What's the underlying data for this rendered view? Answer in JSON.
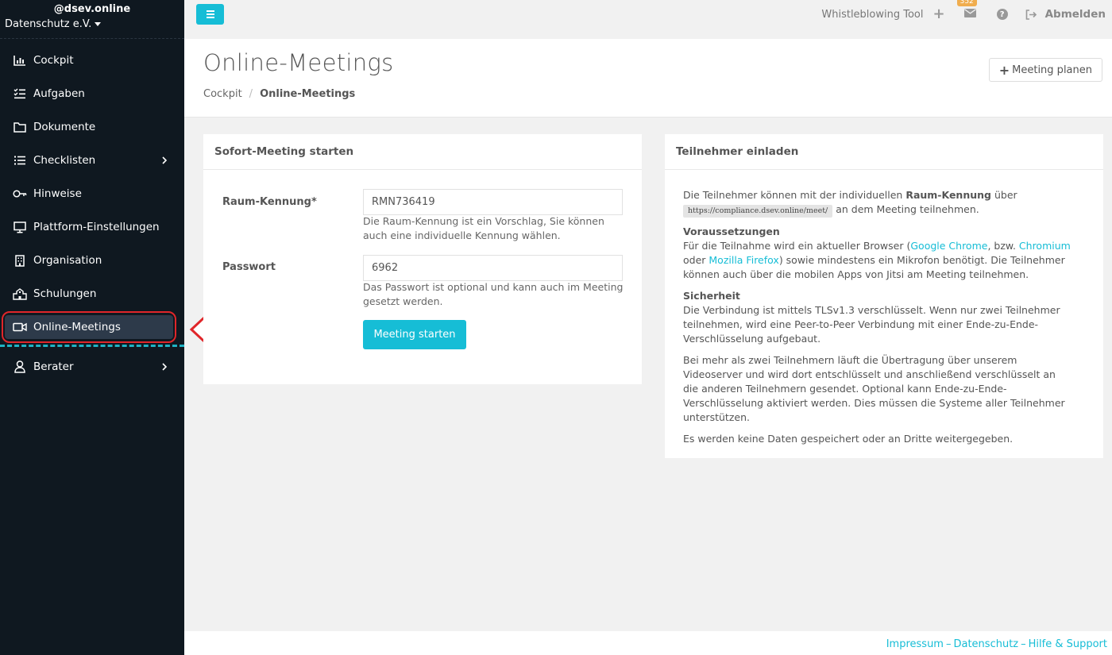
{
  "brand": {
    "name": "@dsev.online",
    "org": "Datenschutz e.V."
  },
  "sidebar": {
    "items": [
      {
        "label": "Cockpit",
        "icon": "chart-icon"
      },
      {
        "label": "Aufgaben",
        "icon": "tasks-icon"
      },
      {
        "label": "Dokumente",
        "icon": "folder-icon"
      },
      {
        "label": "Checklisten",
        "icon": "list-icon"
      },
      {
        "label": "Hinweise",
        "icon": "key-icon"
      },
      {
        "label": "Plattform-Einstellungen",
        "icon": "monitor-icon"
      },
      {
        "label": "Organisation",
        "icon": "building-icon"
      },
      {
        "label": "Schulungen",
        "icon": "school-icon"
      },
      {
        "label": "Online-Meetings",
        "icon": "video-icon"
      },
      {
        "label": "Berater",
        "icon": "user-icon"
      }
    ],
    "active": "Online-Meetings"
  },
  "topbar": {
    "tool_label": "Whistleblowing Tool",
    "mail_count": "352",
    "logout_label": "Abmelden"
  },
  "header": {
    "title": "Online-Meetings",
    "breadcrumb_root": "Cockpit",
    "breadcrumb_current": "Online-Meetings",
    "plan_button": "Meeting planen"
  },
  "left_card": {
    "title": "Sofort-Meeting starten",
    "room_label": "Raum-Kennung*",
    "room_value": "RMN736419",
    "room_help": "Die Raum-Kennung ist ein Vorschlag, Sie können auch eine individuelle Kennung wählen.",
    "password_label": "Passwort",
    "password_value": "6962",
    "password_help": "Das Passwort ist optional und kann auch im Meeting gesetzt werden.",
    "start_button": "Meeting starten"
  },
  "right_card": {
    "title": "Teilnehmer einladen",
    "intro_pre": "Die Teilnehmer können mit der individuellen ",
    "intro_bold": "Raum-Kennung",
    "intro_mid": " über ",
    "intro_url": "https://compliance.dsev.online/meet/",
    "intro_post": " an dem Meeting teilnehmen.",
    "req_title": "Voraussetzungen",
    "req_pre": "Für die Teilnahme wird ein aktueller Browser (",
    "req_link1": "Google Chrome",
    "req_mid1": ", bzw. ",
    "req_link2": "Chromium",
    "req_mid2": " oder ",
    "req_link3": "Mozilla Firefox",
    "req_post": ") sowie mindestens ein Mikrofon benötigt. Die Teilnehmer können auch über die mobilen Apps von Jitsi am Meeting teilnehmen.",
    "sec_title": "Sicherheit",
    "sec_text": "Die Verbindung ist mittels TLSv1.3 verschlüsselt. Wenn nur zwei Teilnehmer teilnehmen, wird eine Peer-to-Peer Verbindung mit einer Ende-zu-Ende-Verschlüsselung aufgebaut.",
    "more_text": "Bei mehr als zwei Teilnehmern läuft die Übertragung über unserem Videoserver und wird dort entschlüsselt und anschließend verschlüsselt an die anderen Teilnehmern gesendet. Optional kann Ende-zu-Ende-Verschlüsselung aktiviert werden. Dies müssen die Systeme aller Teilnehmer unterstützen.",
    "data_text": "Es werden keine Daten gespeichert oder an Dritte weitergegeben."
  },
  "footer": {
    "link1": "Impressum",
    "link2": "Datenschutz",
    "link3": "Hilfe & Support",
    "separator": "–"
  },
  "colors": {
    "accent": "#16bdd6",
    "sidebar_bg": "#0f1820",
    "highlight": "#e0262a",
    "badge": "#f0ad4e"
  }
}
